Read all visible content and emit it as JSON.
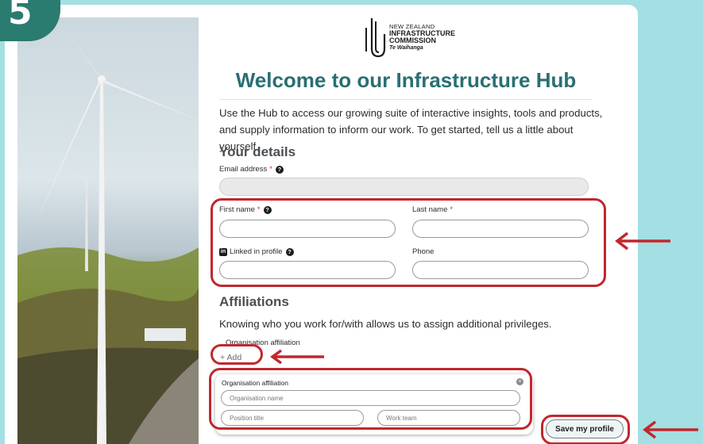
{
  "step": "5",
  "logo": {
    "line1": "NEW ZEALAND",
    "line2": "INFRASTRUCTURE",
    "line3": "COMMISSION",
    "line4": "Te Waihanga"
  },
  "title": "Welcome to our Infrastructure Hub",
  "intro": "Use the Hub to access our growing suite of interactive insights, tools and products, and supply information to inform our work. To get started, tell us a little about yourself.",
  "details": {
    "heading": "Your details",
    "email_label": "Email address",
    "first_name_label": "First name",
    "last_name_label": "Last name",
    "linkedin_label": "Linked in profile",
    "phone_label": "Phone",
    "required_mark": "*",
    "help_glyph": "?",
    "linkedin_glyph": "in"
  },
  "affiliations": {
    "heading": "Affiliations",
    "description": "Knowing who you work for/with allows us to assign additional privileges.",
    "org_label": "Organisation affiliation",
    "add_label": "+ Add",
    "panel": {
      "title": "Organisation affiliation",
      "org_name_placeholder": "Organisation name",
      "position_placeholder": "Position title",
      "work_team_placeholder": "Work team"
    }
  },
  "save_button": "Save my profile",
  "colors": {
    "page_bg": "#a3dfe3",
    "heading": "#2a6f73",
    "badge": "#2a7b70",
    "highlight": "#c1272d"
  }
}
